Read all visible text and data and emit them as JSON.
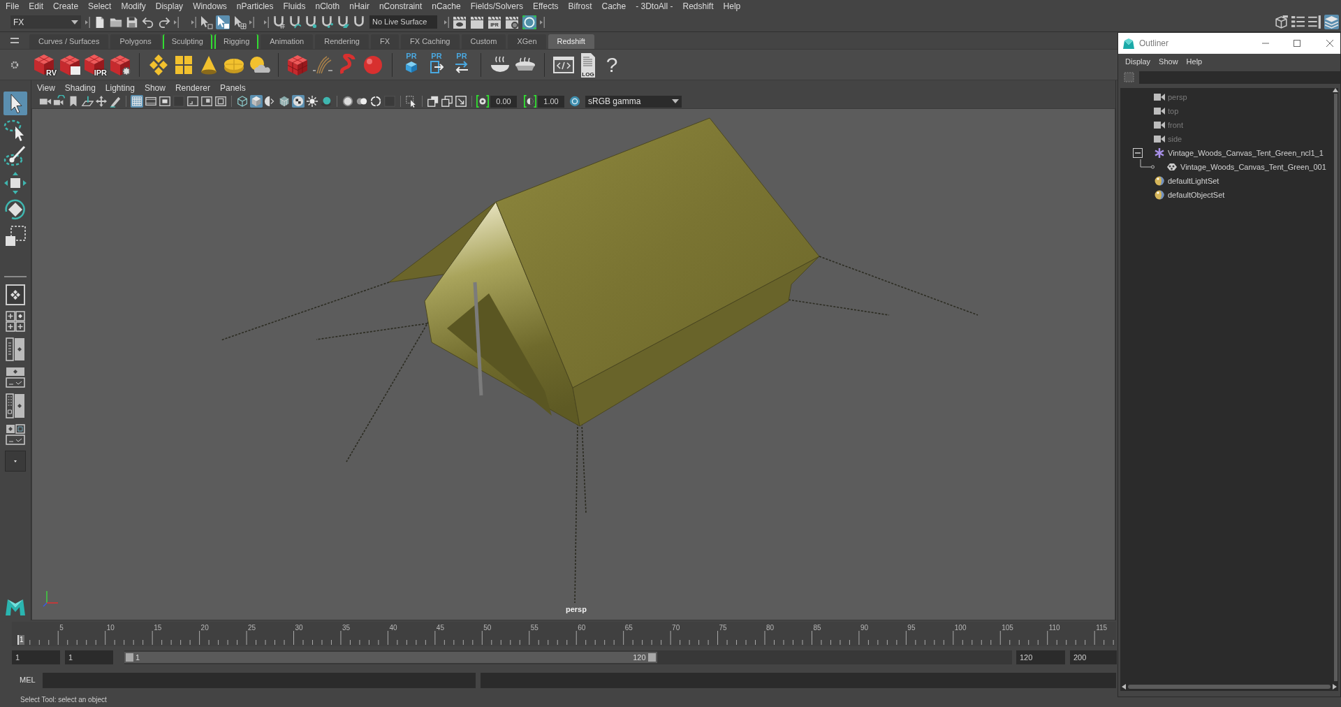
{
  "menu_bar": [
    "File",
    "Edit",
    "Create",
    "Select",
    "Modify",
    "Display",
    "Windows",
    "nParticles",
    "Fluids",
    "nCloth",
    "nHair",
    "nConstraint",
    "nCache",
    "Fields/Solvers",
    "Effects",
    "Bifrost",
    "Cache",
    "- 3DtoAll -",
    "Redshift",
    "Help"
  ],
  "status_line": {
    "menu_set": "FX",
    "selection_modes": [
      {
        "selected": false
      },
      {
        "selected": true
      },
      {
        "selected": false
      }
    ],
    "live_surface": "No Live Surface",
    "render_tools": [
      {
        "on": false
      },
      {
        "on": false
      },
      {
        "label": "IPR",
        "on": false
      },
      {
        "on": false
      },
      {
        "on": true
      }
    ],
    "panel_toggles": [
      {
        "on": false
      },
      {
        "on": false
      },
      {
        "on": false
      },
      {
        "on": true
      }
    ]
  },
  "shelf": {
    "tabs": [
      {
        "label": "Curves / Surfaces",
        "selected": false,
        "marked": false
      },
      {
        "label": "Polygons",
        "selected": false,
        "marked": false
      },
      {
        "label": "Sculpting",
        "selected": false,
        "marked": true
      },
      {
        "label": "Rigging",
        "selected": false,
        "marked": true
      },
      {
        "label": "Animation",
        "selected": false,
        "marked": false
      },
      {
        "label": "Rendering",
        "selected": false,
        "marked": false
      },
      {
        "label": "FX",
        "selected": false,
        "marked": false
      },
      {
        "label": "FX Caching",
        "selected": false,
        "marked": false
      },
      {
        "label": "Custom",
        "selected": false,
        "marked": false
      },
      {
        "label": "XGen",
        "selected": false,
        "marked": false
      },
      {
        "label": "Redshift",
        "selected": true,
        "marked": false
      }
    ],
    "button_labels": [
      "RV",
      "IPR",
      "PR",
      "PR",
      "PR",
      "LOG",
      "?"
    ]
  },
  "tool_box": {
    "tools": [
      {
        "selected": true
      },
      {
        "selected": false
      },
      {
        "selected": false
      },
      {
        "selected": false
      },
      {
        "selected": false
      },
      {
        "selected": false
      }
    ]
  },
  "viewport": {
    "menus": [
      "View",
      "Shading",
      "Lighting",
      "Show",
      "Renderer",
      "Panels"
    ],
    "toolbar": [
      {
        "on": false
      },
      {
        "on": false
      },
      {
        "on": false
      },
      {
        "on": false
      },
      {
        "on": false
      },
      {
        "on": false
      },
      {
        "on": true
      },
      {
        "on": false
      },
      {
        "on": false
      },
      {
        "on": false
      },
      {
        "on": false
      },
      {
        "on": false
      },
      {
        "on": false
      },
      {
        "on": false
      },
      {
        "on": true
      },
      {
        "on": false
      },
      {
        "on": false
      },
      {
        "on": true
      },
      {
        "on": false
      },
      {
        "on": false
      },
      {
        "on": false
      },
      {
        "on": false
      },
      {
        "on": false
      },
      {
        "on": false
      },
      {
        "on": false
      },
      {
        "on": false
      },
      {
        "on": false
      },
      {
        "on": false
      }
    ],
    "exposure": {
      "value": "0.00",
      "on": true
    },
    "gamma": {
      "value": "1.00",
      "on": true
    },
    "color_management": {
      "on": true,
      "view_transform": "sRGB gamma"
    },
    "camera": "persp"
  },
  "outliner": {
    "title": "Outliner",
    "menus": [
      "Display",
      "Show",
      "Help"
    ],
    "items": [
      {
        "label": "persp",
        "kind": "camera",
        "dimmed": true
      },
      {
        "label": "top",
        "kind": "camera",
        "dimmed": true
      },
      {
        "label": "front",
        "kind": "camera",
        "dimmed": true
      },
      {
        "label": "side",
        "kind": "camera",
        "dimmed": true
      },
      {
        "label": "Vintage_Woods_Canvas_Tent_Green_ncl1_1",
        "kind": "transform",
        "dimmed": false,
        "expanded": true,
        "children": [
          {
            "label": "Vintage_Woods_Canvas_Tent_Green_001",
            "kind": "mesh",
            "dimmed": false
          }
        ]
      },
      {
        "label": "defaultLightSet",
        "kind": "set",
        "dimmed": false
      },
      {
        "label": "defaultObjectSet",
        "kind": "set",
        "dimmed": false
      }
    ]
  },
  "timeline": {
    "frame_labels": [
      "5",
      "10",
      "15",
      "20",
      "25",
      "30",
      "35",
      "40",
      "45",
      "50",
      "55",
      "60",
      "65",
      "70",
      "75",
      "80",
      "85",
      "90",
      "95",
      "100",
      "105",
      "110",
      "115"
    ],
    "current_frame": "1"
  },
  "range_slider": {
    "start": "1",
    "playback_start": "1",
    "range_start": "1",
    "range_end": "120",
    "playback_end": "120",
    "end": "200",
    "level": 0.6
  },
  "command_line": {
    "language": "MEL"
  },
  "help_line": "Select Tool: select an object"
}
